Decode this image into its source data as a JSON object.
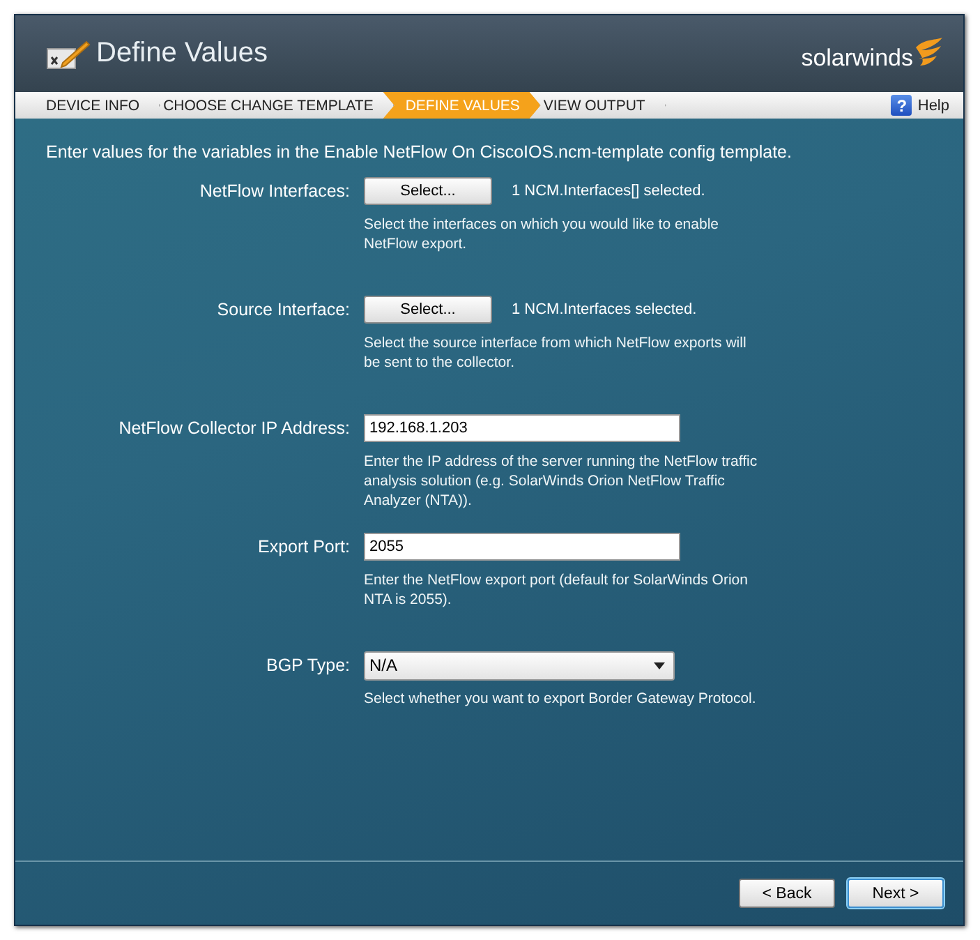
{
  "window": {
    "title": "Define Values",
    "brand": "solarwinds"
  },
  "steps": [
    {
      "label": "DEVICE INFO",
      "selected": false
    },
    {
      "label": "CHOOSE CHANGE TEMPLATE",
      "selected": false
    },
    {
      "label": "DEFINE VALUES",
      "selected": true
    },
    {
      "label": "VIEW OUTPUT",
      "selected": false
    }
  ],
  "help": {
    "glyph": "?",
    "label": "Help"
  },
  "intro": "Enter values for the variables in the Enable NetFlow On CiscoIOS.ncm-template config template.",
  "fields": [
    {
      "kind": "picker",
      "label": "NetFlow Interfaces:",
      "button": "Select...",
      "status": "1 NCM.Interfaces[] selected.",
      "hint": "Select the interfaces on which you would like to enable NetFlow export."
    },
    {
      "kind": "picker",
      "label": "Source Interface:",
      "button": "Select...",
      "status": "1 NCM.Interfaces selected.",
      "hint": "Select the source interface from which NetFlow exports will be sent to the collector."
    },
    {
      "kind": "text",
      "label": "NetFlow Collector IP Address:",
      "value": "192.168.1.203",
      "hint": "Enter the IP address of the server running the NetFlow traffic analysis solution (e.g. SolarWinds Orion NetFlow Traffic Analyzer (NTA))."
    },
    {
      "kind": "text",
      "label": "Export Port:",
      "value": "2055",
      "hint": "Enter the NetFlow export port (default for SolarWinds Orion NTA is 2055)."
    },
    {
      "kind": "select",
      "label": "BGP Type:",
      "value": "N/A",
      "hint": "Select whether you want to export Border Gateway Protocol."
    }
  ],
  "buttons": [
    {
      "label": "< Back",
      "selected": false
    },
    {
      "label": "Next >",
      "selected": true
    }
  ]
}
